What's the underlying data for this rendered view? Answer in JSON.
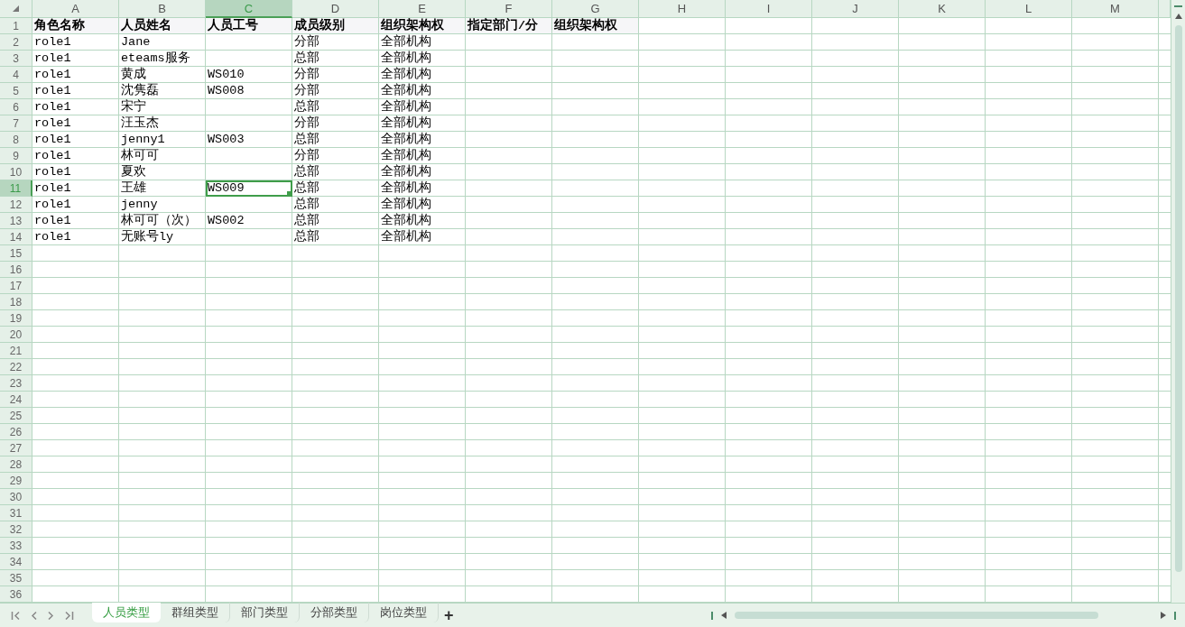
{
  "columns": [
    {
      "label": "A",
      "selected": false
    },
    {
      "label": "B",
      "selected": false
    },
    {
      "label": "C",
      "selected": true
    },
    {
      "label": "D",
      "selected": false
    },
    {
      "label": "E",
      "selected": false
    },
    {
      "label": "F",
      "selected": false
    },
    {
      "label": "G",
      "selected": false
    },
    {
      "label": "H",
      "selected": false
    },
    {
      "label": "I",
      "selected": false
    },
    {
      "label": "J",
      "selected": false
    },
    {
      "label": "K",
      "selected": false
    },
    {
      "label": "L",
      "selected": false
    },
    {
      "label": "M",
      "selected": false
    }
  ],
  "rows": [
    {
      "number": "1",
      "kind": "header",
      "selected": false,
      "cells": [
        "角色名称",
        "人员姓名",
        "人员工号",
        "成员级别",
        "组织架构权",
        "指定部门/分",
        "组织架构权"
      ]
    },
    {
      "number": "2",
      "kind": "data",
      "selected": false,
      "cells": [
        "role1",
        "Jane",
        null,
        "分部",
        "全部机构"
      ]
    },
    {
      "number": "3",
      "kind": "data",
      "selected": false,
      "cells": [
        "role1",
        "eteams服务",
        null,
        "总部",
        "全部机构"
      ]
    },
    {
      "number": "4",
      "kind": "data",
      "selected": false,
      "cells": [
        "role1",
        "黄成",
        "WS010",
        "分部",
        "全部机构"
      ]
    },
    {
      "number": "5",
      "kind": "data",
      "selected": false,
      "cells": [
        "role1",
        "沈隽磊",
        "WS008",
        "分部",
        "全部机构"
      ]
    },
    {
      "number": "6",
      "kind": "data",
      "selected": false,
      "cells": [
        "role1",
        "宋宁",
        null,
        "总部",
        "全部机构"
      ]
    },
    {
      "number": "7",
      "kind": "data",
      "selected": false,
      "cells": [
        "role1",
        "汪玉杰",
        null,
        "分部",
        "全部机构"
      ]
    },
    {
      "number": "8",
      "kind": "data",
      "selected": false,
      "cells": [
        "role1",
        "jenny1",
        "WS003",
        "总部",
        "全部机构"
      ]
    },
    {
      "number": "9",
      "kind": "data",
      "selected": false,
      "cells": [
        "role1",
        "林可可",
        null,
        "分部",
        "全部机构"
      ]
    },
    {
      "number": "10",
      "kind": "data",
      "selected": false,
      "cells": [
        "role1",
        "夏欢",
        null,
        "总部",
        "全部机构"
      ]
    },
    {
      "number": "11",
      "kind": "data",
      "selected": true,
      "cells": [
        "role1",
        "王雄",
        "WS009",
        "总部",
        "全部机构"
      ]
    },
    {
      "number": "12",
      "kind": "data",
      "selected": false,
      "cells": [
        "role1",
        "jenny",
        null,
        "总部",
        "全部机构"
      ]
    },
    {
      "number": "13",
      "kind": "data",
      "selected": false,
      "cells": [
        "role1",
        "林可可（次）",
        "WS002",
        "总部",
        "全部机构"
      ]
    },
    {
      "number": "14",
      "kind": "data",
      "selected": false,
      "cells": [
        "role1",
        "无账号ly",
        null,
        "总部",
        "全部机构"
      ]
    },
    {
      "number": "15",
      "kind": "data",
      "selected": false
    },
    {
      "number": "16",
      "kind": "data",
      "selected": false
    },
    {
      "number": "17",
      "kind": "data",
      "selected": false
    },
    {
      "number": "18",
      "kind": "data",
      "selected": false
    },
    {
      "number": "19",
      "kind": "data",
      "selected": false
    },
    {
      "number": "20",
      "kind": "data",
      "selected": false
    },
    {
      "number": "21",
      "kind": "data",
      "selected": false
    },
    {
      "number": "22",
      "kind": "data",
      "selected": false
    },
    {
      "number": "23",
      "kind": "data",
      "selected": false
    },
    {
      "number": "24",
      "kind": "data",
      "selected": false
    },
    {
      "number": "25",
      "kind": "data",
      "selected": false
    },
    {
      "number": "26",
      "kind": "data",
      "selected": false
    },
    {
      "number": "27",
      "kind": "data",
      "selected": false
    },
    {
      "number": "28",
      "kind": "data",
      "selected": false
    },
    {
      "number": "29",
      "kind": "data",
      "selected": false
    },
    {
      "number": "30",
      "kind": "data",
      "selected": false
    },
    {
      "number": "31",
      "kind": "data",
      "selected": false
    },
    {
      "number": "32",
      "kind": "data",
      "selected": false
    },
    {
      "number": "33",
      "kind": "data",
      "selected": false
    },
    {
      "number": "34",
      "kind": "data",
      "selected": false
    },
    {
      "number": "35",
      "kind": "data",
      "selected": false
    },
    {
      "number": "36",
      "kind": "data",
      "selected": false
    }
  ],
  "sheet_tabs": [
    {
      "label": "人员类型",
      "selected": true
    },
    {
      "label": "群组类型",
      "selected": false
    },
    {
      "label": "部门类型",
      "selected": false
    },
    {
      "label": "分部类型",
      "selected": false
    },
    {
      "label": "岗位类型",
      "selected": false
    }
  ],
  "add_sheet": "+"
}
